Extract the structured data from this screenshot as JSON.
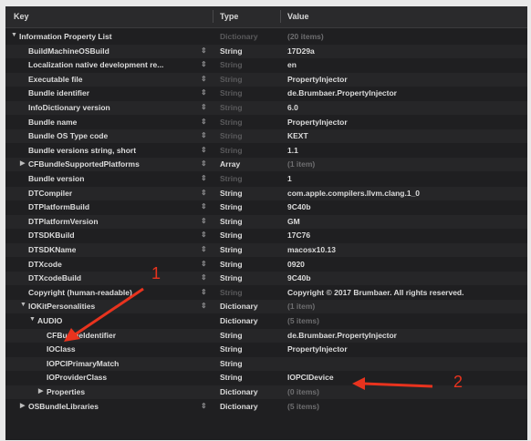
{
  "header": {
    "key": "Key",
    "type": "Type",
    "value": "Value"
  },
  "rows": [
    {
      "key": "Information Property List",
      "type": "Dictionary",
      "value": "(20 items)",
      "level": 0,
      "disc": "▼",
      "stepper": false,
      "typeDim": true,
      "valueDim": true
    },
    {
      "key": "BuildMachineOSBuild",
      "type": "String",
      "value": "17D29a",
      "level": 1,
      "disc": "",
      "stepper": true,
      "typeDim": false,
      "valueDim": false
    },
    {
      "key": "Localization native development re...",
      "type": "String",
      "value": "en",
      "level": 1,
      "disc": "",
      "stepper": true,
      "typeDim": true,
      "valueDim": false
    },
    {
      "key": "Executable file",
      "type": "String",
      "value": "PropertyInjector",
      "level": 1,
      "disc": "",
      "stepper": true,
      "typeDim": true,
      "valueDim": false
    },
    {
      "key": "Bundle identifier",
      "type": "String",
      "value": "de.Brumbaer.PropertyInjector",
      "level": 1,
      "disc": "",
      "stepper": true,
      "typeDim": true,
      "valueDim": false
    },
    {
      "key": "InfoDictionary version",
      "type": "String",
      "value": "6.0",
      "level": 1,
      "disc": "",
      "stepper": true,
      "typeDim": true,
      "valueDim": false
    },
    {
      "key": "Bundle name",
      "type": "String",
      "value": "PropertyInjector",
      "level": 1,
      "disc": "",
      "stepper": true,
      "typeDim": true,
      "valueDim": false
    },
    {
      "key": "Bundle OS Type code",
      "type": "String",
      "value": "KEXT",
      "level": 1,
      "disc": "",
      "stepper": true,
      "typeDim": true,
      "valueDim": false
    },
    {
      "key": "Bundle versions string, short",
      "type": "String",
      "value": "1.1",
      "level": 1,
      "disc": "",
      "stepper": true,
      "typeDim": true,
      "valueDim": false
    },
    {
      "key": "CFBundleSupportedPlatforms",
      "type": "Array",
      "value": "(1 item)",
      "level": 1,
      "disc": "▶",
      "stepper": true,
      "typeDim": false,
      "valueDim": true
    },
    {
      "key": "Bundle version",
      "type": "String",
      "value": "1",
      "level": 1,
      "disc": "",
      "stepper": true,
      "typeDim": true,
      "valueDim": false
    },
    {
      "key": "DTCompiler",
      "type": "String",
      "value": "com.apple.compilers.llvm.clang.1_0",
      "level": 1,
      "disc": "",
      "stepper": true,
      "typeDim": false,
      "valueDim": false
    },
    {
      "key": "DTPlatformBuild",
      "type": "String",
      "value": "9C40b",
      "level": 1,
      "disc": "",
      "stepper": true,
      "typeDim": false,
      "valueDim": false
    },
    {
      "key": "DTPlatformVersion",
      "type": "String",
      "value": "GM",
      "level": 1,
      "disc": "",
      "stepper": true,
      "typeDim": false,
      "valueDim": false
    },
    {
      "key": "DTSDKBuild",
      "type": "String",
      "value": "17C76",
      "level": 1,
      "disc": "",
      "stepper": true,
      "typeDim": false,
      "valueDim": false
    },
    {
      "key": "DTSDKName",
      "type": "String",
      "value": "macosx10.13",
      "level": 1,
      "disc": "",
      "stepper": true,
      "typeDim": false,
      "valueDim": false
    },
    {
      "key": "DTXcode",
      "type": "String",
      "value": "0920",
      "level": 1,
      "disc": "",
      "stepper": true,
      "typeDim": false,
      "valueDim": false
    },
    {
      "key": "DTXcodeBuild",
      "type": "String",
      "value": "9C40b",
      "level": 1,
      "disc": "",
      "stepper": true,
      "typeDim": false,
      "valueDim": false
    },
    {
      "key": "Copyright (human-readable)",
      "type": "String",
      "value": "Copyright © 2017 Brumbaer. All rights reserved.",
      "level": 1,
      "disc": "",
      "stepper": true,
      "typeDim": true,
      "valueDim": false
    },
    {
      "key": "IOKitPersonalities",
      "type": "Dictionary",
      "value": "(1 item)",
      "level": 1,
      "disc": "▼",
      "stepper": true,
      "typeDim": false,
      "valueDim": true
    },
    {
      "key": "AUDIO",
      "type": "Dictionary",
      "value": "(5 items)",
      "level": 2,
      "disc": "▼",
      "stepper": false,
      "typeDim": false,
      "valueDim": true
    },
    {
      "key": "CFBundleIdentifier",
      "type": "String",
      "value": "de.Brumbaer.PropertyInjector",
      "level": 3,
      "disc": "",
      "stepper": false,
      "typeDim": false,
      "valueDim": false
    },
    {
      "key": "IOClass",
      "type": "String",
      "value": "PropertyInjector",
      "level": 3,
      "disc": "",
      "stepper": false,
      "typeDim": false,
      "valueDim": false
    },
    {
      "key": "IOPCIPrimaryMatch",
      "type": "String",
      "value": "",
      "level": 3,
      "disc": "",
      "stepper": false,
      "typeDim": false,
      "valueDim": false
    },
    {
      "key": "IOProviderClass",
      "type": "String",
      "value": "IOPCIDevice",
      "level": 3,
      "disc": "",
      "stepper": false,
      "typeDim": false,
      "valueDim": false
    },
    {
      "key": "Properties",
      "type": "Dictionary",
      "value": "(0 items)",
      "level": 3,
      "disc": "▶",
      "stepper": false,
      "typeDim": false,
      "valueDim": true
    },
    {
      "key": "OSBundleLibraries",
      "type": "Dictionary",
      "value": "(5 items)",
      "level": 1,
      "disc": "▶",
      "stepper": true,
      "typeDim": false,
      "valueDim": true
    }
  ],
  "annotations": {
    "label1": "1",
    "label2": "2"
  },
  "colors": {
    "panel": "#1f1f21",
    "annotation": "#e8331e"
  }
}
